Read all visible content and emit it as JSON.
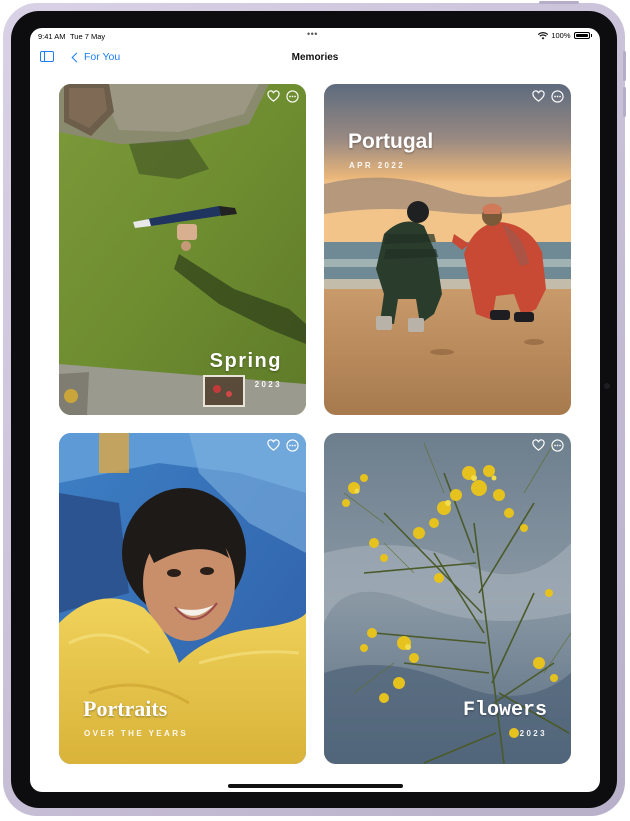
{
  "status_bar": {
    "time": "9:41 AM",
    "date": "Tue 7 May",
    "dots": "•••",
    "battery": "100%"
  },
  "nav": {
    "back_label": "For You",
    "title": "Memories"
  },
  "memories": [
    {
      "title": "Spring",
      "subtitle": "2023",
      "theme": "grass-aerial"
    },
    {
      "title": "Portugal",
      "subtitle": "APR 2022",
      "theme": "beach-sunset"
    },
    {
      "title": "Portraits",
      "subtitle": "OVER THE YEARS",
      "theme": "portrait-yellow-sweater"
    },
    {
      "title": "Flowers",
      "subtitle": "2023",
      "theme": "yellow-flowers-sky"
    }
  ],
  "colors": {
    "accent": "#1a7ff5",
    "device_frame": "#c9c0d8",
    "bezel": "#0d0d0f"
  }
}
